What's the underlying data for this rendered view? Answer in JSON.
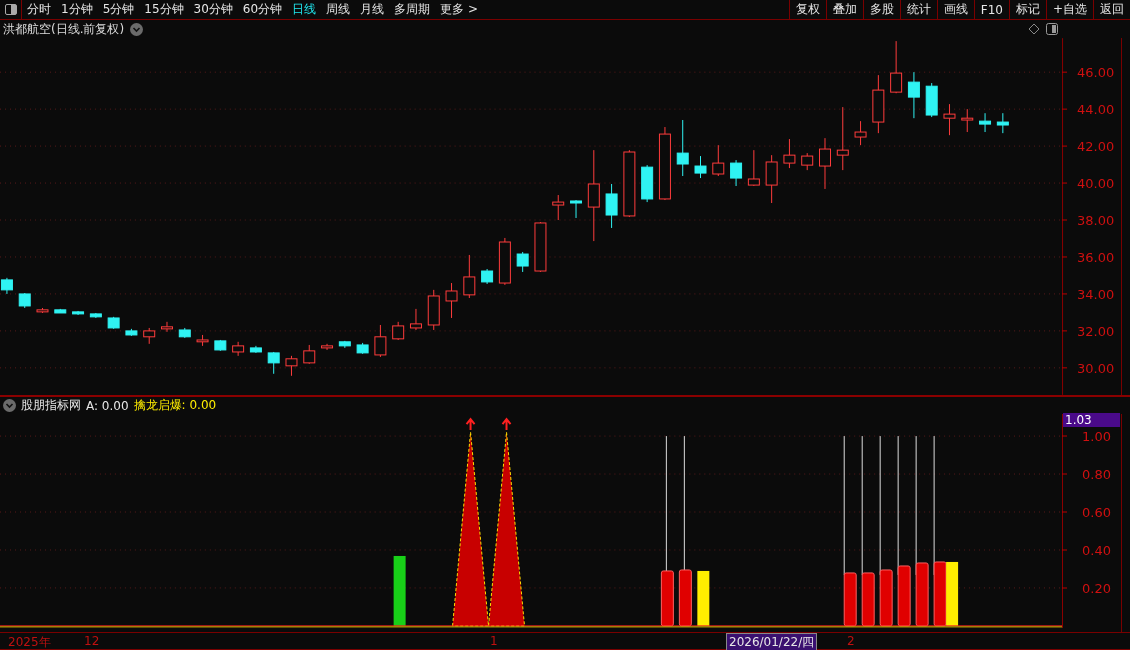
{
  "toolbar": {
    "periods": [
      {
        "label": "分时",
        "selected": false
      },
      {
        "label": "1分钟",
        "selected": false
      },
      {
        "label": "5分钟",
        "selected": false
      },
      {
        "label": "15分钟",
        "selected": false
      },
      {
        "label": "30分钟",
        "selected": false
      },
      {
        "label": "60分钟",
        "selected": false
      },
      {
        "label": "日线",
        "selected": true
      },
      {
        "label": "周线",
        "selected": false
      },
      {
        "label": "月线",
        "selected": false
      },
      {
        "label": "多周期",
        "selected": false
      },
      {
        "label": "更多 >",
        "selected": false
      }
    ],
    "buttons": [
      "复权",
      "叠加",
      "多股",
      "统计",
      "画线",
      "F10",
      "标记",
      "+自选",
      "返回"
    ]
  },
  "chart": {
    "title": "洪都航空(日线.前复权)",
    "chart_data": {
      "type": "candlestick",
      "grid": true,
      "ylim": [
        28.54,
        47.84
      ],
      "categories": [
        null,
        null,
        null,
        null,
        null,
        null,
        null,
        null,
        null,
        null,
        null,
        null,
        null,
        null,
        null,
        null,
        null,
        null,
        null,
        null,
        null,
        null,
        null,
        null,
        null,
        null,
        null,
        null,
        null,
        null,
        null,
        null,
        null,
        null,
        null,
        null,
        null,
        null,
        null,
        null,
        null,
        null,
        null,
        null,
        null,
        null,
        null,
        null,
        null,
        null,
        null,
        null,
        null,
        null,
        null,
        null,
        null
      ],
      "yticks": [
        {
          "value": 46,
          "label": "46.00"
        },
        {
          "value": 44,
          "label": "44.00"
        },
        {
          "value": 42,
          "label": "42.00"
        },
        {
          "value": 40,
          "label": "40.00"
        },
        {
          "value": 38,
          "label": "38.00"
        },
        {
          "value": 36,
          "label": "36.00"
        },
        {
          "value": 34,
          "label": "34.00"
        },
        {
          "value": 32,
          "label": "32.00"
        },
        {
          "value": 30,
          "label": "30.00"
        }
      ],
      "ohlc": [
        [
          34.76,
          34.87,
          34.0,
          34.22
        ],
        [
          34.0,
          34.05,
          33.24,
          33.35
        ],
        [
          33.03,
          33.24,
          32.97,
          33.14
        ],
        [
          33.14,
          33.19,
          32.97,
          32.97
        ],
        [
          33.03,
          33.08,
          32.86,
          32.92
        ],
        [
          32.92,
          32.97,
          32.7,
          32.76
        ],
        [
          32.7,
          32.76,
          32.11,
          32.16
        ],
        [
          32.0,
          32.11,
          31.73,
          31.78
        ],
        [
          31.68,
          32.16,
          31.3,
          32.0
        ],
        [
          32.11,
          32.49,
          31.95,
          32.22
        ],
        [
          32.05,
          32.16,
          31.62,
          31.68
        ],
        [
          31.41,
          31.78,
          31.19,
          31.51
        ],
        [
          31.46,
          31.51,
          30.92,
          30.97
        ],
        [
          30.86,
          31.41,
          30.65,
          31.19
        ],
        [
          31.08,
          31.19,
          30.81,
          30.86
        ],
        [
          30.81,
          30.86,
          29.68,
          30.27
        ],
        [
          30.11,
          30.65,
          29.57,
          30.49
        ],
        [
          30.27,
          31.24,
          30.22,
          30.92
        ],
        [
          31.08,
          31.3,
          30.97,
          31.19
        ],
        [
          31.41,
          31.46,
          31.08,
          31.19
        ],
        [
          31.24,
          31.35,
          30.76,
          30.81
        ],
        [
          30.7,
          32.32,
          30.59,
          31.68
        ],
        [
          31.57,
          32.49,
          31.51,
          32.27
        ],
        [
          32.16,
          33.19,
          32.05,
          32.38
        ],
        [
          32.32,
          34.22,
          32.05,
          33.89
        ],
        [
          33.62,
          34.59,
          32.7,
          34.16
        ],
        [
          33.95,
          36.11,
          33.78,
          34.92
        ],
        [
          35.24,
          35.35,
          34.54,
          34.65
        ],
        [
          34.59,
          37.03,
          34.49,
          36.81
        ],
        [
          36.16,
          36.27,
          35.19,
          35.51
        ],
        [
          35.24,
          37.89,
          35.19,
          37.84
        ],
        [
          38.81,
          39.35,
          38.0,
          38.97
        ],
        [
          39.03,
          39.08,
          38.11,
          38.92
        ],
        [
          38.7,
          41.78,
          36.86,
          39.95
        ],
        [
          39.41,
          39.95,
          37.57,
          38.27
        ],
        [
          38.22,
          41.78,
          38.16,
          41.68
        ],
        [
          40.86,
          40.97,
          38.97,
          39.14
        ],
        [
          39.14,
          43.03,
          39.08,
          42.65
        ],
        [
          41.62,
          43.41,
          40.38,
          41.03
        ],
        [
          40.92,
          41.46,
          40.27,
          40.54
        ],
        [
          40.49,
          42.05,
          40.38,
          41.08
        ],
        [
          41.08,
          41.24,
          39.84,
          40.27
        ],
        [
          39.89,
          41.78,
          39.84,
          40.22
        ],
        [
          39.89,
          41.51,
          38.92,
          41.14
        ],
        [
          41.08,
          42.38,
          40.81,
          41.51
        ],
        [
          40.97,
          41.62,
          40.7,
          41.46
        ],
        [
          40.92,
          42.43,
          39.68,
          41.84
        ],
        [
          41.51,
          44.11,
          40.7,
          41.78
        ],
        [
          42.49,
          43.35,
          42.05,
          42.76
        ],
        [
          43.3,
          45.84,
          42.7,
          45.03
        ],
        [
          44.92,
          47.68,
          44.86,
          45.95
        ],
        [
          45.46,
          46.0,
          43.51,
          44.65
        ],
        [
          45.24,
          45.41,
          43.57,
          43.68
        ],
        [
          43.51,
          44.27,
          42.59,
          43.73
        ],
        [
          43.41,
          44.0,
          42.76,
          43.51
        ],
        [
          43.35,
          43.78,
          42.76,
          43.19
        ],
        [
          43.3,
          43.78,
          42.7,
          43.14
        ]
      ]
    }
  },
  "indicator": {
    "name": "股朋指标网",
    "a_value": "A: 0.00",
    "signal": "擒龙启爆: 0.00",
    "current": "1.03",
    "ticks": [
      "1.00",
      "0.80",
      "0.60",
      "0.40",
      "0.20"
    ]
  },
  "date_axis": [
    {
      "label": "2025年",
      "selected": false
    },
    {
      "label": "12",
      "selected": false
    },
    {
      "label": "1",
      "selected": false
    },
    {
      "label": "2026/01/22/四",
      "selected": true
    },
    {
      "label": "2",
      "selected": false
    }
  ]
}
